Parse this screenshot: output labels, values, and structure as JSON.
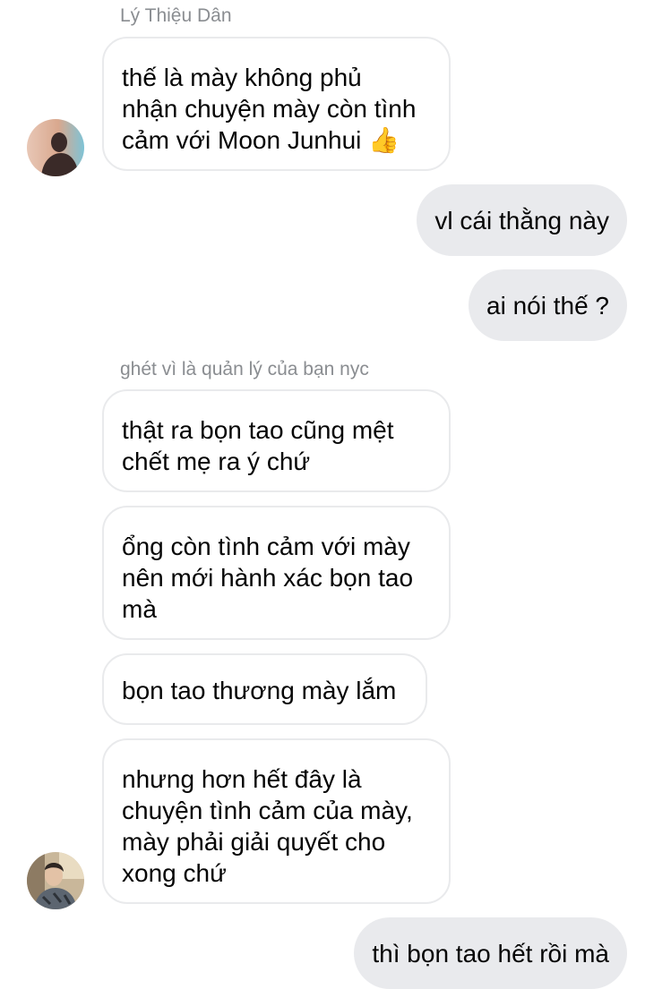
{
  "chat": {
    "groups": [
      {
        "sender": "Lý Thiệu Dân",
        "messages": [
          "thế là mày không phủ\nnhận chuyện mày còn tình\ncảm với Moon Junhui 👍"
        ]
      },
      {
        "sender": "ghét vì là quản lý của bạn nyc",
        "messages": [
          "thật ra bọn tao cũng mệt\nchết mẹ ra ý chứ",
          "ổng còn tình cảm với mày\nnên mới hành xác bọn tao\nmà",
          "bọn tao thương mày lắm",
          "nhưng hơn hết đây là\nchuyện tình cảm của mày,\nmày phải giải quyết cho\nxong chứ"
        ]
      }
    ],
    "outgoing": [
      "vl cái thằng này",
      "ai nói thế ?",
      "thì bọn tao hết rồi mà"
    ],
    "avatars": {
      "first": "silhouette-avatar",
      "second": "photo-avatar"
    },
    "colors": {
      "incoming_bubble_bg": "#ffffff",
      "incoming_bubble_border": "#e9eaec",
      "outgoing_bubble_bg": "#e9eaed",
      "text": "#050505",
      "sender_name": "#8a8d91"
    }
  }
}
